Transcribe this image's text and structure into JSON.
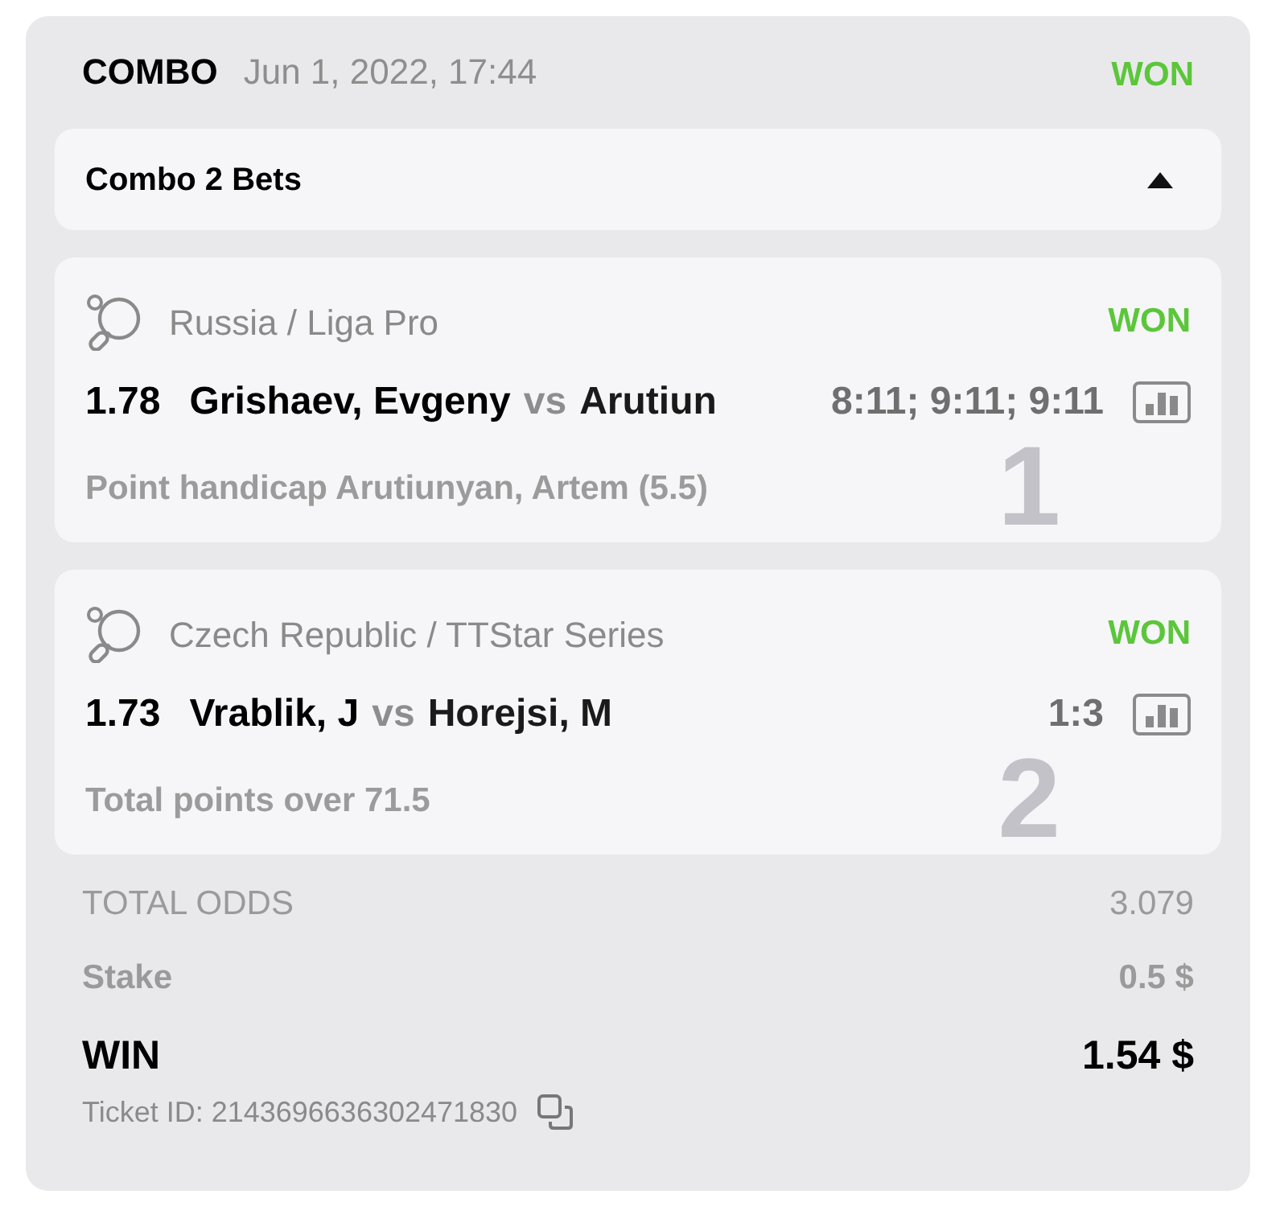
{
  "ticket": {
    "type": "COMBO",
    "date": "Jun 1, 2022, 17:44",
    "status": "WON",
    "color": "#5cc63b"
  },
  "combo_toggle": {
    "label": "Combo 2 Bets",
    "expanded": true
  },
  "bets": [
    {
      "index": "1",
      "league": "Russia / Liga Pro",
      "status": "WON",
      "color": "#5cc63b",
      "odds": "1.78",
      "home": "Grishaev, Evgeny",
      "vs": "vs",
      "away": "Arutiun",
      "score": "8:11; 9:11; 9:11",
      "market": "Point handicap Arutiunyan, Artem (5.5)"
    },
    {
      "index": "2",
      "league": "Czech Republic / TTStar Series",
      "status": "WON",
      "color": "#5cc63b",
      "odds": "1.73",
      "home": "Vrablik, J",
      "vs": "vs",
      "away": "Horejsi, M",
      "score": "1:3",
      "market": "Total points over 71.5"
    }
  ],
  "summary": {
    "total_odds_label": "TOTAL ODDS",
    "total_odds": "3.079",
    "stake_label": "Stake",
    "stake": "0.5 $",
    "win_label": "WIN",
    "win": "1.54 $",
    "ticket_id": "Ticket ID: 2143696636302471830"
  }
}
